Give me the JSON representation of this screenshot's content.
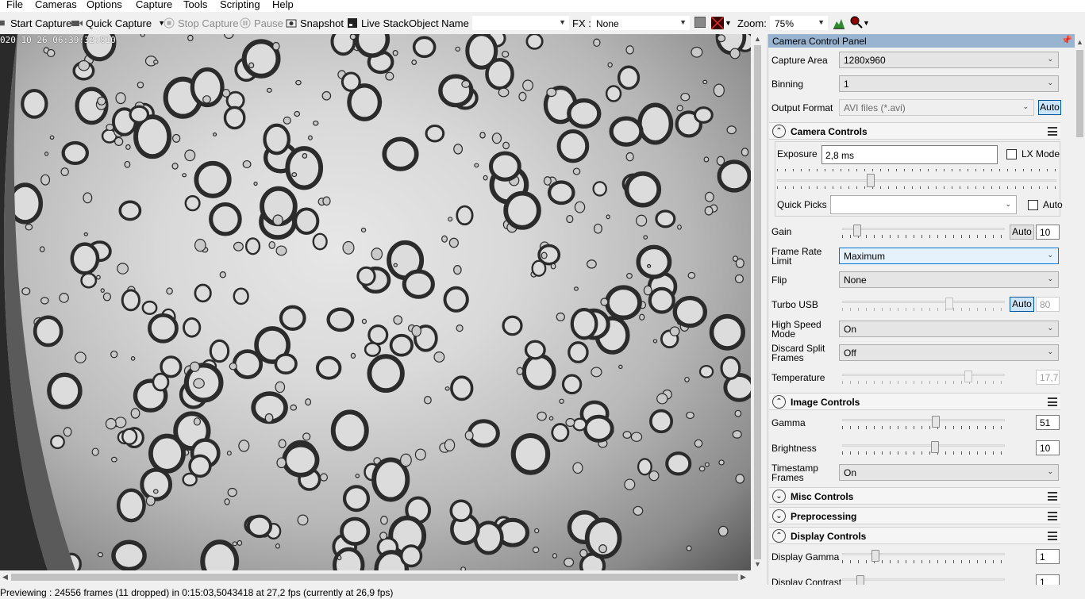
{
  "menu": [
    "File",
    "Cameras",
    "Options",
    "Capture",
    "Tools",
    "Scripting",
    "Help"
  ],
  "toolbar": {
    "start_capture": "Start Capture",
    "quick_capture": "Quick Capture",
    "stop_capture": "Stop Capture",
    "pause": "Pause",
    "snapshot": "Snapshot",
    "live_stack": "Live Stack",
    "object_name_label": "Object Name :",
    "object_name_value": "",
    "fx_label": "FX :",
    "fx_value": "None",
    "zoom_label": "Zoom:",
    "zoom_value": "75%"
  },
  "viewer": {
    "timestamp": "020 10 26 06:39:32:810"
  },
  "status": {
    "text": "Previewing : 24556 frames (11 dropped) in 0:15:03,5043418 at 27,2 fps  (currently at 26,9 fps)"
  },
  "panel": {
    "title": "Camera Control Panel",
    "capture_area_label": "Capture Area",
    "capture_area_value": "1280x960",
    "binning_label": "Binning",
    "binning_value": "1",
    "output_format_label": "Output Format",
    "output_format_value": "AVI files (*.avi)",
    "auto_label": "Auto",
    "camera_controls": {
      "title": "Camera Controls",
      "exposure_label": "Exposure",
      "exposure_value": "2,8 ms",
      "lx_mode_label": "LX Mode",
      "quick_picks_label": "Quick Picks",
      "quick_picks_value": "",
      "quick_picks_auto": "Auto",
      "gain_label": "Gain",
      "gain_value": "10",
      "frame_rate_label_1": "Frame Rate",
      "frame_rate_label_2": "Limit",
      "frame_rate_value": "Maximum",
      "flip_label": "Flip",
      "flip_value": "None",
      "turbo_usb_label": "Turbo USB",
      "turbo_usb_value": "80",
      "high_speed_label_1": "High Speed",
      "high_speed_label_2": "Mode",
      "high_speed_value": "On",
      "discard_split_label_1": "Discard Split",
      "discard_split_label_2": "Frames",
      "discard_split_value": "Off",
      "temperature_label": "Temperature",
      "temperature_value": "17,7"
    },
    "image_controls": {
      "title": "Image Controls",
      "gamma_label": "Gamma",
      "gamma_value": "51",
      "brightness_label": "Brightness",
      "brightness_value": "10",
      "timestamp_label_1": "Timestamp",
      "timestamp_label_2": "Frames",
      "timestamp_value": "On"
    },
    "misc_controls": {
      "title": "Misc Controls"
    },
    "preprocessing": {
      "title": "Preprocessing"
    },
    "display_controls": {
      "title": "Display Controls",
      "display_gamma_label": "Display Gamma",
      "display_gamma_value": "1",
      "display_contrast_label": "Display Contrast",
      "display_contrast_value": "1"
    }
  },
  "colors": {
    "panel_title_bg": "#99b4d1",
    "auto_active_bg": "#cce4f7",
    "selected_border": "#0078d7"
  }
}
